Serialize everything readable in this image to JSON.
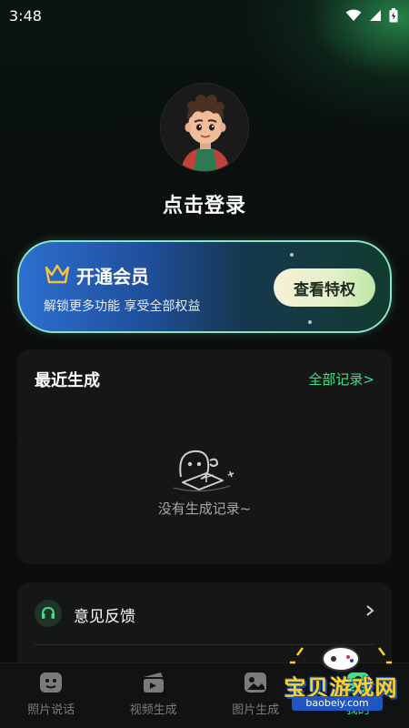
{
  "status_bar": {
    "time": "3:48",
    "icons": [
      "wifi-icon",
      "signal-icon",
      "battery-icon"
    ]
  },
  "profile": {
    "avatar": "avatar",
    "login_text": "点击登录"
  },
  "vip_card": {
    "title": "开通会员",
    "subtitle": "解锁更多功能 享受全部权益",
    "button_label": "查看特权",
    "icon": "crown-icon"
  },
  "recent": {
    "title": "最近生成",
    "all_link": "全部记录>",
    "empty_text": "没有生成记录~",
    "illustration": "empty-state-icon"
  },
  "menu": {
    "items": [
      {
        "label": "意见反馈",
        "icon": "headset-icon"
      }
    ]
  },
  "tabbar": {
    "tabs": [
      {
        "label": "照片说话",
        "icon": "face-icon"
      },
      {
        "label": "视频生成",
        "icon": "clapperboard-icon"
      },
      {
        "label": "图片生成",
        "icon": "image-icon"
      },
      {
        "label": "我的",
        "icon": "profile-icon"
      }
    ]
  },
  "watermark": {
    "text": "宝贝游戏网",
    "url": "baobeiy.com"
  },
  "colors": {
    "accent_green": "#3fe08a",
    "vip_border": "#8ae6c8",
    "card_bg": "#151616"
  }
}
